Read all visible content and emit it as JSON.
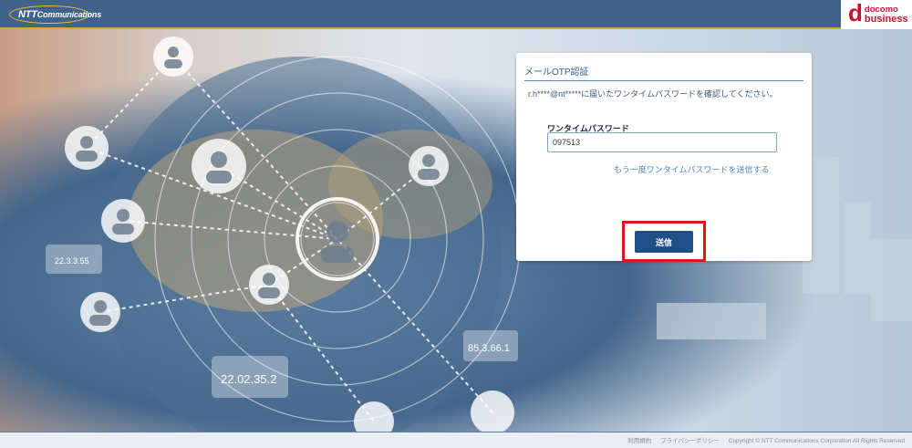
{
  "header": {
    "brand_left_prefix": "NTT",
    "brand_left_suffix": "Communications",
    "brand_right_mark": "d",
    "brand_right_line1": "docomo",
    "brand_right_line2": "business"
  },
  "background": {
    "ip_labels": [
      "22.3.3.55",
      "85.3.66.1",
      "22.02.35.2"
    ]
  },
  "panel": {
    "title": "メールOTP認証",
    "description": "r.h****@nt*****に届いたワンタイムパスワードを確認してください。",
    "field_label": "ワンタイムパスワード",
    "otp_value": "097513",
    "resend_link": "もう一度ワンタイムパスワードを送信する",
    "submit_label": "送信"
  },
  "footer": {
    "terms": "利用規約",
    "privacy": "プライバシーポリシー",
    "copyright": "Copyright © NTT Communications Corporation All Rights Reserved"
  },
  "colors": {
    "header_bg": "#41638b",
    "header_accent": "#d9a43a",
    "brand_red": "#c8102e",
    "button_bg": "#1f4e88",
    "highlight_border": "#e4141b",
    "link": "#4b86c2"
  }
}
